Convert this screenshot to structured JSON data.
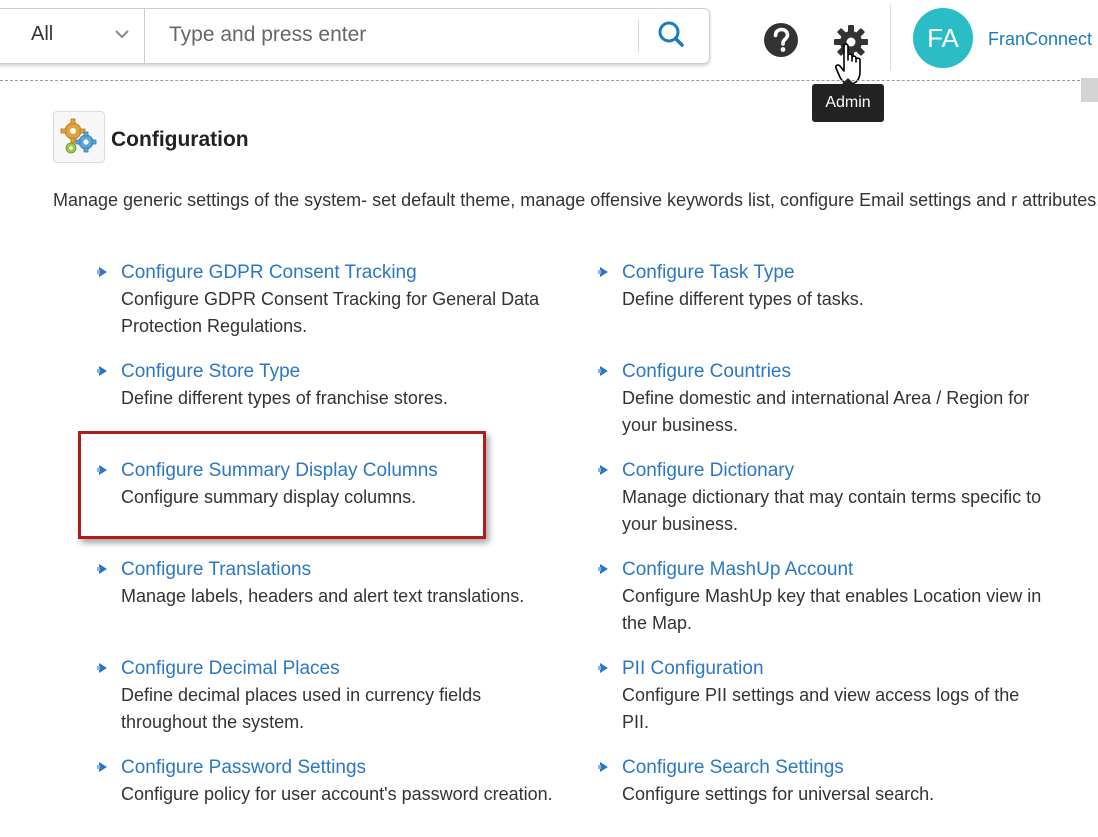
{
  "search": {
    "scope_value": "All",
    "placeholder": "Type and press enter"
  },
  "header": {
    "avatar_initials": "FA",
    "user_name": "FranConnect",
    "tooltip": "Admin"
  },
  "page": {
    "title": "Configuration",
    "description": "Manage generic settings of the system- set default theme, manage offensive keywords list, configure Email settings and r attributes."
  },
  "items_left": [
    {
      "label": "Configure GDPR Consent Tracking",
      "desc": "Configure GDPR Consent Tracking for General Data Protection Regulations."
    },
    {
      "label": "Configure Store Type",
      "desc": "Define different types of franchise stores."
    },
    {
      "label": "Configure Summary Display Columns",
      "desc": "Configure summary display columns."
    },
    {
      "label": "Configure Translations",
      "desc": "Manage labels, headers and alert text translations."
    },
    {
      "label": "Configure Decimal Places",
      "desc": "Define decimal places used in currency fields throughout the system."
    },
    {
      "label": "Configure Password Settings",
      "desc": "Configure policy for user account's password creation."
    }
  ],
  "items_right": [
    {
      "label": "Configure Task Type",
      "desc": "Define different types of tasks."
    },
    {
      "label": "Configure Countries",
      "desc": "Define domestic and international Area / Region for your business."
    },
    {
      "label": "Configure Dictionary",
      "desc": "Manage dictionary that may contain terms specific to your business."
    },
    {
      "label": "Configure MashUp Account",
      "desc": "Configure MashUp key that enables Location view in the Map."
    },
    {
      "label": "PII Configuration",
      "desc": "Configure PII settings and view access logs of the PII."
    },
    {
      "label": "Configure Search Settings",
      "desc": "Configure settings for universal search."
    }
  ],
  "colors": {
    "link": "#2a78c5",
    "avatar": "#2bbdc6",
    "highlight": "#b01c1c"
  },
  "icons": [
    "chevron-down-icon",
    "search-icon",
    "help-icon",
    "gear-icon",
    "hand-cursor-icon",
    "configuration-gears-icon",
    "bullet-icon"
  ]
}
